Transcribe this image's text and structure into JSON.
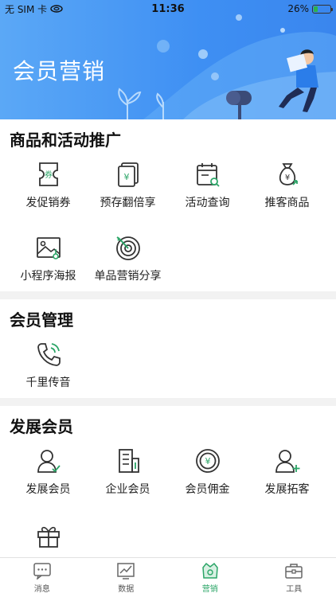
{
  "status_bar": {
    "carrier": "无 SIM 卡",
    "time": "11:36",
    "battery": "26%",
    "battery_level": 0.26
  },
  "banner": {
    "title": "会员营销"
  },
  "sections": [
    {
      "title": "商品和活动推广",
      "items": [
        {
          "label": "发促销券",
          "icon": "coupon-icon",
          "badge": "券"
        },
        {
          "label": "预存翻倍享",
          "icon": "deposit-icon",
          "badge": "¥"
        },
        {
          "label": "活动查询",
          "icon": "calendar-search-icon"
        },
        {
          "label": "推客商品",
          "icon": "money-bag-icon",
          "badge": "¥"
        },
        {
          "label": "小程序海报",
          "icon": "poster-icon"
        },
        {
          "label": "单品营销分享",
          "icon": "target-icon"
        }
      ]
    },
    {
      "title": "会员管理",
      "items": [
        {
          "label": "千里传音",
          "icon": "phone-call-icon"
        }
      ]
    },
    {
      "title": "发展会员",
      "items": [
        {
          "label": "发展会员",
          "icon": "user-check-icon"
        },
        {
          "label": "企业会员",
          "icon": "building-icon"
        },
        {
          "label": "会员佣金",
          "icon": "coin-icon",
          "badge": "¥"
        },
        {
          "label": "发展拓客",
          "icon": "user-add-icon"
        },
        {
          "label": "",
          "icon": "gift-icon"
        }
      ]
    }
  ],
  "tabbar": [
    {
      "label": "消息",
      "icon": "message-icon",
      "active": false
    },
    {
      "label": "数据",
      "icon": "chart-icon",
      "active": false
    },
    {
      "label": "营销",
      "icon": "shop-icon",
      "active": true
    },
    {
      "label": "工具",
      "icon": "toolbox-icon",
      "active": false
    }
  ],
  "colors": {
    "accent": "#2ba567",
    "banner": "#3e8ff3",
    "icon": "#333333"
  }
}
